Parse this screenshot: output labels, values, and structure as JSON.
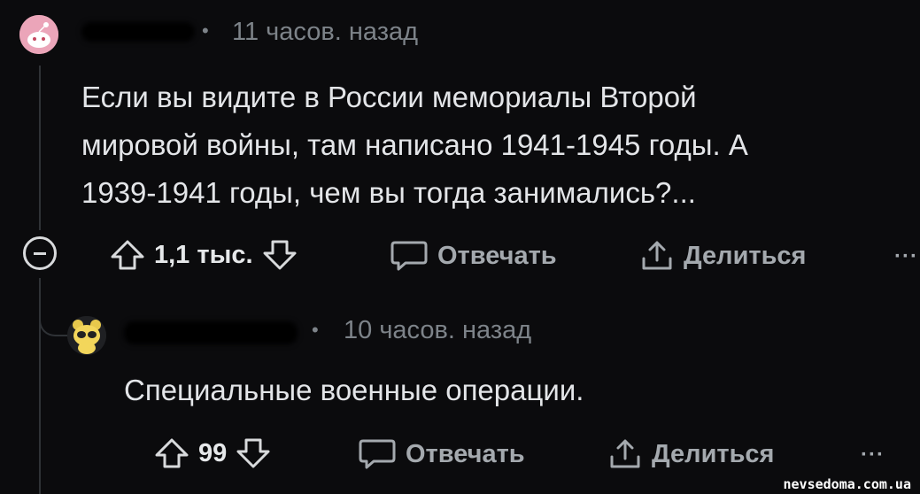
{
  "comment1": {
    "username": "",
    "time_ago": "11 часов. назад",
    "lines": [
      "Если вы видите в России мемориалы Второй",
      "мировой войны, там написано 1941-1945 годы. А",
      "1939-1941 годы, чем вы тогда занимались?..."
    ],
    "votes": "1,1 тыс.",
    "reply_label": "Отвечать",
    "share_label": "Делиться",
    "more_label": "···"
  },
  "comment2": {
    "username": "",
    "time_ago": "10 часов. назад",
    "lines": [
      "Специальные военные операции."
    ],
    "votes": "99",
    "reply_label": "Отвечать",
    "share_label": "Делиться",
    "more_label": "···"
  },
  "watermark": "nevsedoma.com.ua",
  "icons": {
    "upvote": "upvote-arrow-icon",
    "downvote": "downvote-arrow-icon",
    "reply": "comment-bubble-icon",
    "share": "share-icon",
    "collapse": "collapse-minus-icon"
  }
}
